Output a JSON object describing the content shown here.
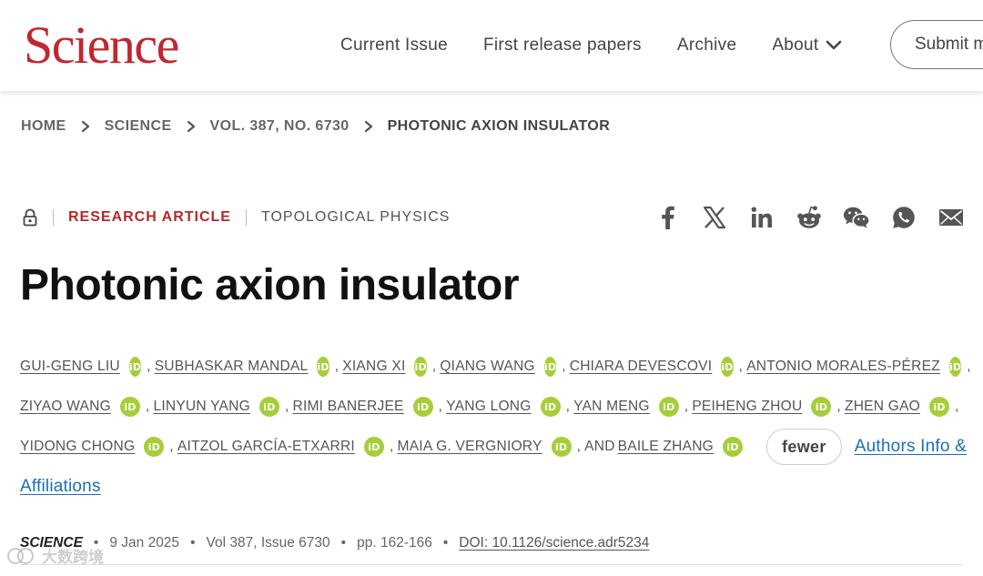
{
  "header": {
    "logo": "Science",
    "nav": [
      {
        "label": "Current Issue"
      },
      {
        "label": "First release papers"
      },
      {
        "label": "Archive"
      },
      {
        "label": "About"
      }
    ],
    "submit_label": "Submit m"
  },
  "breadcrumb": [
    "HOME",
    "SCIENCE",
    "VOL. 387, NO. 6730",
    "PHOTONIC AXION INSULATOR"
  ],
  "article": {
    "type": "RESEARCH ARTICLE",
    "topic": "TOPOLOGICAL PHYSICS",
    "title": "Photonic axion insulator",
    "share_icons": [
      "facebook-icon",
      "x-icon",
      "linkedin-icon",
      "reddit-icon",
      "wechat-icon",
      "whatsapp-icon",
      "email-icon"
    ],
    "authors_line1": [
      "GUI-GENG LIU",
      "SUBHASKAR MANDAL",
      "XIANG XI",
      "QIANG WANG",
      "CHIARA DEVESCOVI",
      "ANTONIO MORALES-PÉREZ"
    ],
    "authors_line2": [
      "ZIYAO WANG",
      "LINYUN YANG",
      "RIMI BANERJEE",
      "YANG LONG",
      "YAN MENG",
      "PEIHENG ZHOU",
      "ZHEN GAO"
    ],
    "authors_line3": [
      "YIDONG CHONG",
      "AITZOL GARCÍA-ETXARRI",
      "MAIA G. VERGNIORY",
      "BAILE ZHANG"
    ],
    "and_text": "AND",
    "orcid_label": "iD",
    "fewer_label": "fewer",
    "info_link_part1": "Authors Info &",
    "info_link_part2": "Affiliations"
  },
  "citation": {
    "journal": "SCIENCE",
    "date": "9 Jan 2025",
    "volume": "Vol 387, Issue 6730",
    "pages": "pp. 162-166",
    "doi": "DOI: 10.1126/science.adr5234"
  },
  "watermark": "大数跨境",
  "colors": {
    "brand": "#c1272d",
    "article_type": "#b22a2a",
    "orcid": "#a6ce39",
    "link": "#1a6fb5"
  }
}
